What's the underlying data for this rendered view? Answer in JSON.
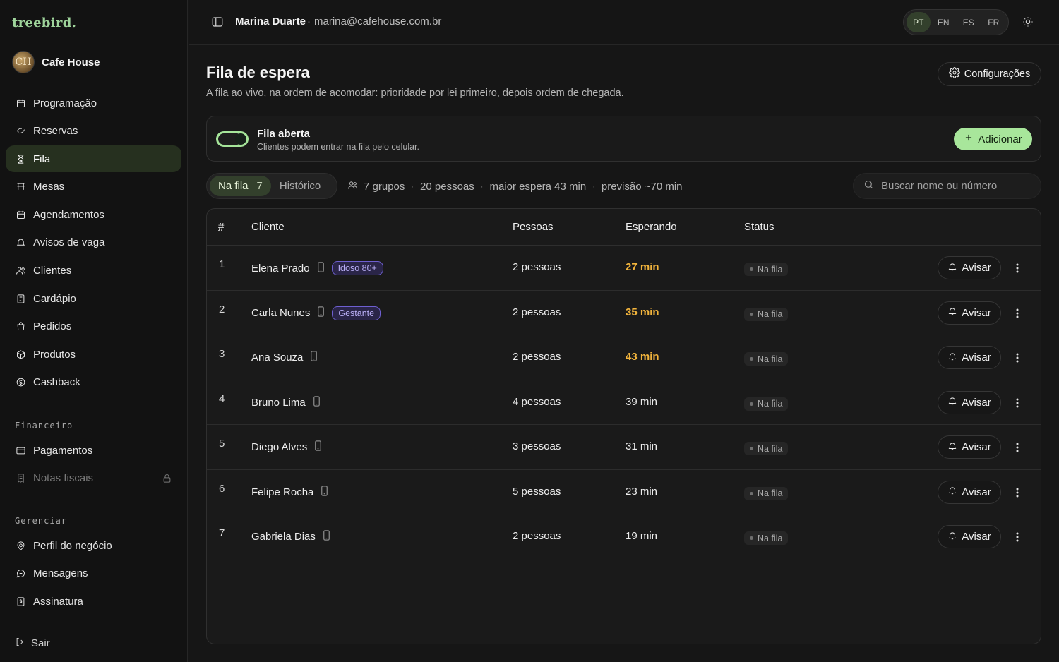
{
  "brand": {
    "logo": "treebird."
  },
  "business": {
    "name": "Cafe House",
    "avatar_letter": "CH"
  },
  "sidebar": {
    "items": [
      {
        "label": "Programação",
        "icon": "calendar-icon"
      },
      {
        "label": "Reservas",
        "icon": "reservation-icon"
      },
      {
        "label": "Fila",
        "icon": "hourglass-icon",
        "active": true
      },
      {
        "label": "Mesas",
        "icon": "table-icon"
      },
      {
        "label": "Agendamentos",
        "icon": "calendar-icon"
      },
      {
        "label": "Avisos de vaga",
        "icon": "bell-icon"
      },
      {
        "label": "Clientes",
        "icon": "users-icon"
      },
      {
        "label": "Cardápio",
        "icon": "menu-book-icon"
      },
      {
        "label": "Pedidos",
        "icon": "bag-icon"
      },
      {
        "label": "Produtos",
        "icon": "box-icon"
      },
      {
        "label": "Cashback",
        "icon": "cashback-icon"
      }
    ],
    "financeiro_title": "Financeiro",
    "financeiro_items": [
      {
        "label": "Pagamentos",
        "icon": "card-icon"
      },
      {
        "label": "Notas fiscais",
        "icon": "receipt-icon",
        "locked": true
      }
    ],
    "gerenciar_title": "Gerenciar",
    "gerenciar_items": [
      {
        "label": "Perfil do negócio",
        "icon": "location-icon"
      },
      {
        "label": "Mensagens",
        "icon": "chat-icon"
      },
      {
        "label": "Assinatura",
        "icon": "subscription-icon"
      }
    ],
    "logout_label": "Sair"
  },
  "topbar": {
    "user_name": "Marina Duarte",
    "separator": "·",
    "user_email": "marina@cafehouse.com.br",
    "languages": [
      "PT",
      "EN",
      "ES",
      "FR"
    ],
    "active_language": "PT"
  },
  "page": {
    "title": "Fila de espera",
    "subtitle": "A fila ao vivo, na ordem de acomodar: prioridade por lei primeiro, depois ordem de chegada.",
    "config_label": "Configurações"
  },
  "queue": {
    "title": "Fila aberta",
    "subtitle": "Clientes podem entrar na fila pelo celular.",
    "open": true,
    "add_label": "Adicionar"
  },
  "tabs": {
    "in_queue_label": "Na fila",
    "in_queue_count": "7",
    "history_label": "Histórico"
  },
  "summary": {
    "groups": "7 grupos",
    "people": "20 pessoas",
    "longest_wait": "maior espera 43 min",
    "forecast": "previsão ~70 min"
  },
  "search": {
    "placeholder": "Buscar nome ou número",
    "value": ""
  },
  "table": {
    "columns": [
      "#",
      "Cliente",
      "Pessoas",
      "Esperando",
      "Status"
    ],
    "notify_label": "Avisar",
    "rows": [
      {
        "num": "1",
        "name": "Elena Prado",
        "badge": "Idoso 80+",
        "people": "2 pessoas",
        "wait": "27 min",
        "warn": true,
        "status": "Na fila"
      },
      {
        "num": "2",
        "name": "Carla Nunes",
        "badge": "Gestante",
        "people": "2 pessoas",
        "wait": "35 min",
        "warn": true,
        "status": "Na fila"
      },
      {
        "num": "3",
        "name": "Ana Souza",
        "badge": "",
        "people": "2 pessoas",
        "wait": "43 min",
        "warn": true,
        "status": "Na fila"
      },
      {
        "num": "4",
        "name": "Bruno Lima",
        "badge": "",
        "people": "4 pessoas",
        "wait": "39 min",
        "warn": false,
        "status": "Na fila"
      },
      {
        "num": "5",
        "name": "Diego Alves",
        "badge": "",
        "people": "3 pessoas",
        "wait": "31 min",
        "warn": false,
        "status": "Na fila"
      },
      {
        "num": "6",
        "name": "Felipe Rocha",
        "badge": "",
        "people": "5 pessoas",
        "wait": "23 min",
        "warn": false,
        "status": "Na fila"
      },
      {
        "num": "7",
        "name": "Gabriela Dias",
        "badge": "",
        "people": "2 pessoas",
        "wait": "19 min",
        "warn": false,
        "status": "Na fila"
      }
    ]
  },
  "colors": {
    "accent": "#a8e69b",
    "warn": "#f2b43c",
    "badge": "#6e5fd0"
  }
}
